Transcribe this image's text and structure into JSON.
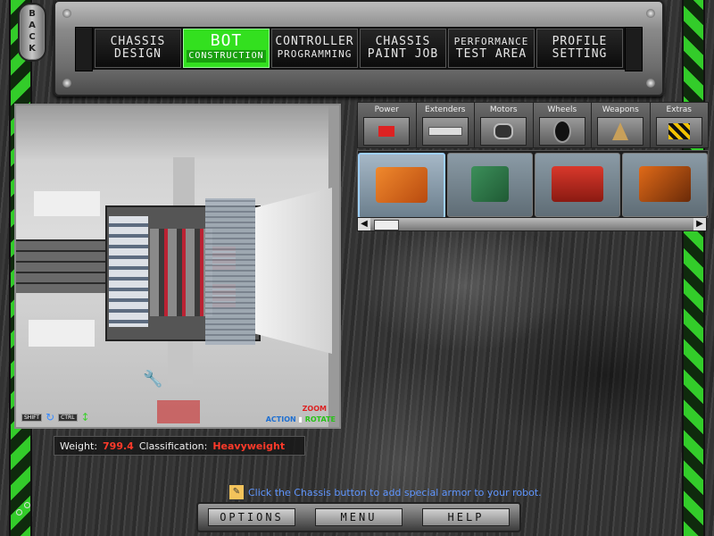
{
  "back_button": {
    "label": "BACK"
  },
  "nav": {
    "tabs": [
      {
        "line1": "CHASSIS",
        "line2": "DESIGN",
        "active": false
      },
      {
        "line1": "BOT",
        "line2": "CONSTRUCTION",
        "active": true
      },
      {
        "line1": "CONTROLLER",
        "line2": "PROGRAMMING",
        "active": false
      },
      {
        "line1": "CHASSIS",
        "line2": "PAINT JOB",
        "active": false
      },
      {
        "line1": "PERFORMANCE",
        "line2": "TEST AREA",
        "active": false
      },
      {
        "line1": "PROFILE",
        "line2": "SETTING",
        "active": false
      }
    ]
  },
  "viewport": {
    "hint_shift": "SHIFT",
    "hint_ctrl": "CTRL",
    "legend_zoom": "ZOOM",
    "legend_action": "ACTION",
    "legend_rotate": "ROTATE"
  },
  "stats": {
    "weight_label": "Weight:",
    "weight_value": "799.4",
    "class_label": "Classification:",
    "class_value": "Heavyweight"
  },
  "part_categories": [
    {
      "label": "Power",
      "icon": "battery-icon"
    },
    {
      "label": "Extenders",
      "icon": "bar-icon"
    },
    {
      "label": "Motors",
      "icon": "motor-icon"
    },
    {
      "label": "Wheels",
      "icon": "wheel-icon"
    },
    {
      "label": "Weapons",
      "icon": "drill-icon"
    },
    {
      "label": "Extras",
      "icon": "hazard-icon"
    }
  ],
  "parts": [
    {
      "name": "orange-battery",
      "color": "#e8741f",
      "selected": true
    },
    {
      "name": "circuit-board",
      "color": "#2f7a4a",
      "selected": false
    },
    {
      "name": "red-battery-pack",
      "color": "#b8281c",
      "selected": false
    },
    {
      "name": "orange-battery-pack",
      "color": "#d45a12",
      "selected": false
    }
  ],
  "hint": {
    "text": "Click the Chassis button to add special armor to your robot."
  },
  "bottom_menu": {
    "options": "OPTIONS",
    "menu": "MENU",
    "help": "HELP"
  }
}
